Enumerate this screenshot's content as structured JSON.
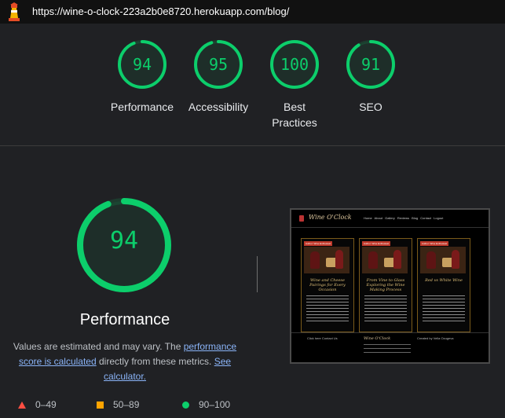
{
  "url_bar": {
    "url": "https://wine-o-clock-223a2b0e8720.herokuapp.com/blog/"
  },
  "colors": {
    "pass": "#0cce6b",
    "average": "#ffa400",
    "fail": "#ff4e42",
    "background": "#202124"
  },
  "scores": [
    {
      "label": "Performance",
      "value": 94
    },
    {
      "label": "Accessibility",
      "value": 95
    },
    {
      "label": "Best Practices",
      "value": 100
    },
    {
      "label": "SEO",
      "value": 91
    }
  ],
  "performance": {
    "score": 94,
    "title": "Performance",
    "note_prefix": "Values are estimated and may vary. The ",
    "note_link1": "performance score is calculated",
    "note_middle": " directly from these metrics. ",
    "note_link2": "See calculator."
  },
  "legend": [
    {
      "icon": "triangle-icon",
      "label": "0–49"
    },
    {
      "icon": "square-icon",
      "label": "50–89"
    },
    {
      "icon": "circle-icon",
      "label": "90–100"
    }
  ],
  "screenshot": {
    "brand": "Wine O'Clock",
    "nav_links": "Home About Gallery Reviews Blog Contact Logout",
    "cards": [
      {
        "tag": "Author: Wine Enthusiast",
        "title": "Wine and Cheese Pairings for Every Occasion"
      },
      {
        "tag": "Author: Wine Enthusiast",
        "title": "From Vine to Glass Exploring the Wine Making Process"
      },
      {
        "tag": "Author: Wine Enthusiast",
        "title": "Red vs White Wine"
      }
    ],
    "footer_left": "Click here Contact Us",
    "footer_center": "Wine O'Clock",
    "footer_right": "Created by Vella Ozugeva"
  }
}
